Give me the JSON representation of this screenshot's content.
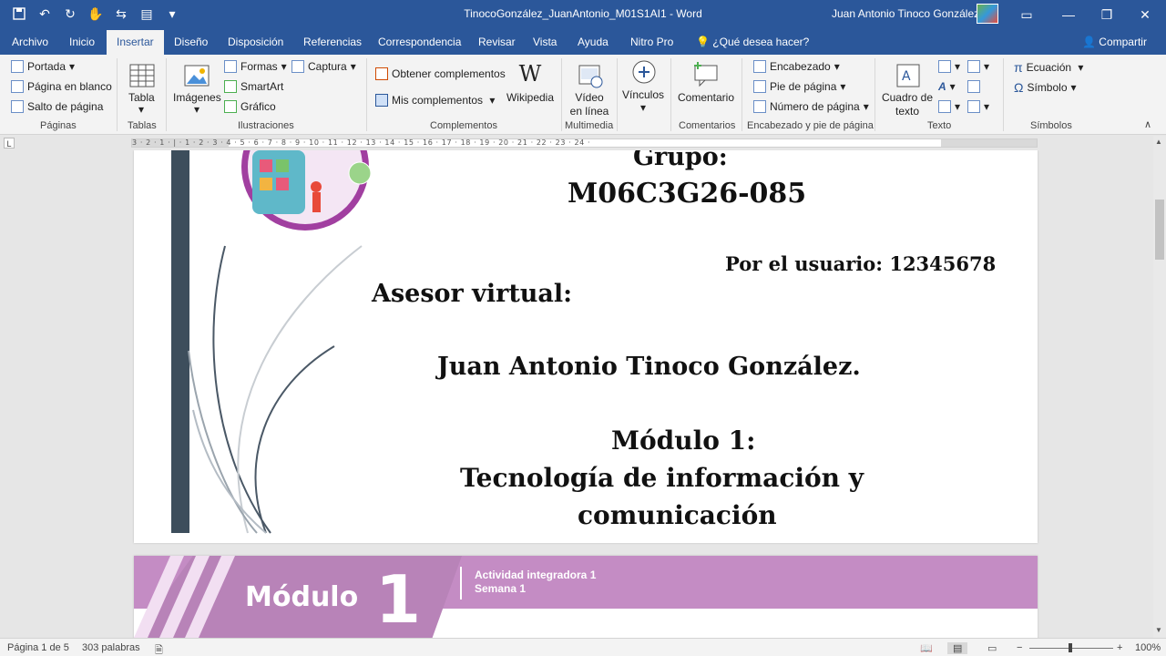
{
  "window": {
    "title": "TinocoGonzález_JuanAntonio_M01S1AI1  -  Word",
    "user": "Juan Antonio Tinoco González"
  },
  "tabs": [
    "Archivo",
    "Inicio",
    "Insertar",
    "Diseño",
    "Disposición",
    "Referencias",
    "Correspondencia",
    "Revisar",
    "Vista",
    "Ayuda",
    "Nitro Pro"
  ],
  "active_tab": "Insertar",
  "tell_me": "¿Qué desea hacer?",
  "share": "Compartir",
  "ribbon": {
    "paginas": {
      "label": "Páginas",
      "portada": "Portada",
      "pagina_en_blanco": "Página en blanco",
      "salto_de_pagina": "Salto de página"
    },
    "tablas": {
      "label": "Tablas",
      "tabla": "Tabla"
    },
    "ilustraciones": {
      "label": "Ilustraciones",
      "imagenes": "Imágenes",
      "formas": "Formas",
      "smartart": "SmartArt",
      "grafico": "Gráfico",
      "captura": "Captura"
    },
    "complementos": {
      "label": "Complementos",
      "obtener": "Obtener complementos",
      "mis": "Mis complementos",
      "wikipedia": "Wikipedia"
    },
    "multimedia": {
      "label": "Multimedia",
      "video_1": "Vídeo",
      "video_2": "en línea"
    },
    "vinculos": {
      "label": "",
      "vinculos": "Vínculos"
    },
    "comentarios": {
      "label": "Comentarios",
      "comentario": "Comentario"
    },
    "encabezado": {
      "label": "Encabezado y pie de página",
      "encabezado": "Encabezado",
      "pie": "Pie de página",
      "numero": "Número de página"
    },
    "texto": {
      "label": "Texto",
      "cuadro_1": "Cuadro de",
      "cuadro_2": "texto"
    },
    "simbolos": {
      "label": "Símbolos",
      "ecuacion": "Ecuación",
      "simbolo": "Símbolo"
    }
  },
  "ruler_text": "3 · 2 · 1 · | · 1 · 2 · 3 · 4 · 5 · 6 · 7 · 8 · 9 · 10 · 11 · 12 · 13 · 14 · 15 · 16 · 17 · 18 · 19 · 20 · 21 · 22 · 23 · 24 ·",
  "document": {
    "grupo_label": "Grupo:",
    "grupo": "M06C3G26-085",
    "usuario": "Por el usuario: 12345678",
    "asesor_label": "Asesor virtual:",
    "asesor_nombre": "Juan Antonio Tinoco González.",
    "modulo": "Módulo 1:",
    "tema_1": "Tecnología de información y",
    "tema_2": "comunicación"
  },
  "page2_banner": {
    "modulo_word": "Módulo",
    "modulo_num": "1",
    "actividad": "Actividad integradora 1",
    "semana": "Semana 1"
  },
  "status": {
    "page": "Página 1 de 5",
    "words": "303 palabras",
    "zoom": "100%"
  },
  "colors": {
    "accent": "#2b579a",
    "banner": "#c48cc4",
    "sidebar_bar": "#3d4e5c"
  }
}
